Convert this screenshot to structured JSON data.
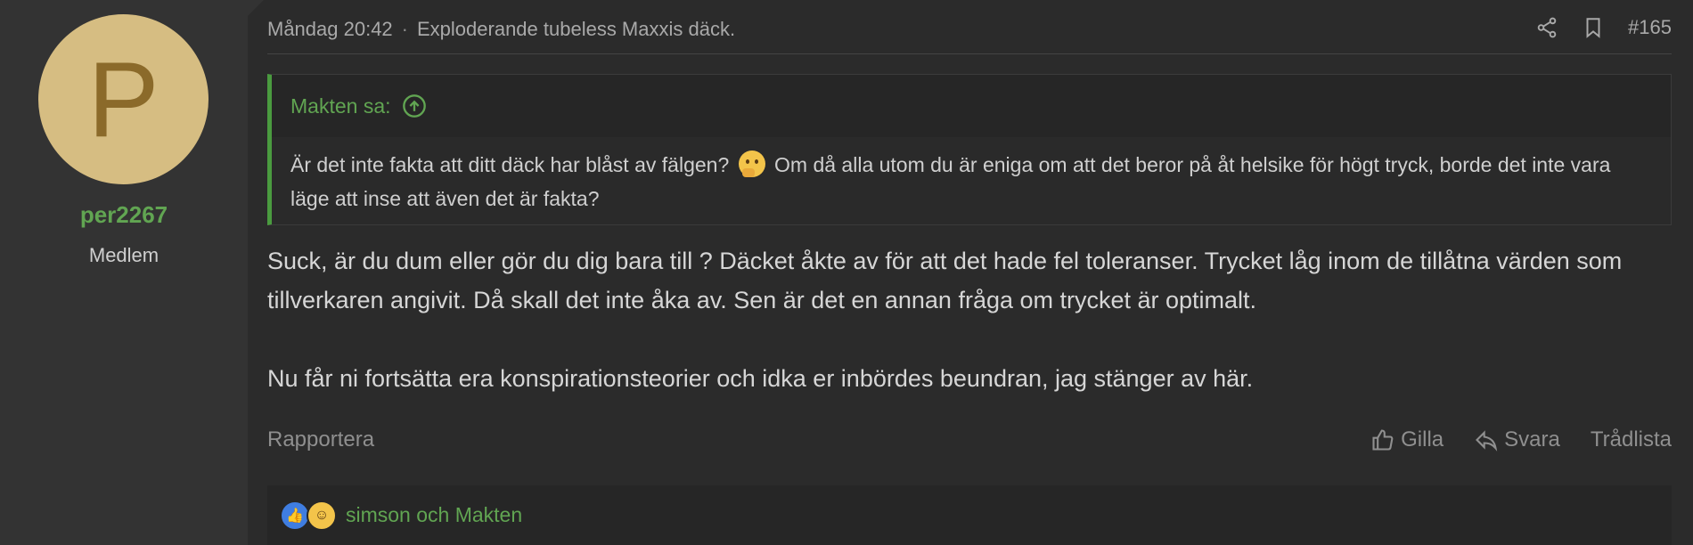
{
  "user": {
    "avatar_letter": "P",
    "name": "per2267",
    "title": "Medlem",
    "avatar_color": "#d6bd82"
  },
  "post": {
    "date": "Måndag 20:42",
    "separator": "·",
    "thread_title": "Exploderande tubeless Maxxis däck.",
    "number": "#165"
  },
  "quote": {
    "author": "Makten sa:",
    "text_before": "Är det inte fakta att ditt däck har blåst av fälgen?",
    "text_after": "Om då alla utom du är eniga om att det beror på åt helsike för högt tryck, borde det inte vara läge att inse att även det är fakta?",
    "emoji": "thinking-face"
  },
  "message": {
    "p1": "Suck, är du dum eller gör du dig bara till ? Däcket åkte av för att det hade fel toleranser. Trycket låg inom de tillåtna värden som tillverkaren angivit. Då skall det inte åka av. Sen är det en annan fråga om trycket är optimalt.",
    "p2": "Nu får ni fortsätta era konspirationsteorier och idka er inbördes beundran, jag stänger av här."
  },
  "actions": {
    "report": "Rapportera",
    "like": "Gilla",
    "reply": "Svara",
    "threadlist": "Trådlista"
  },
  "reactions": {
    "icons": [
      "like",
      "haha"
    ],
    "users": "simson och Makten"
  },
  "colors": {
    "accent_green": "#61a552",
    "quote_border": "#4a9b3f",
    "background": "#2b2b2b"
  }
}
